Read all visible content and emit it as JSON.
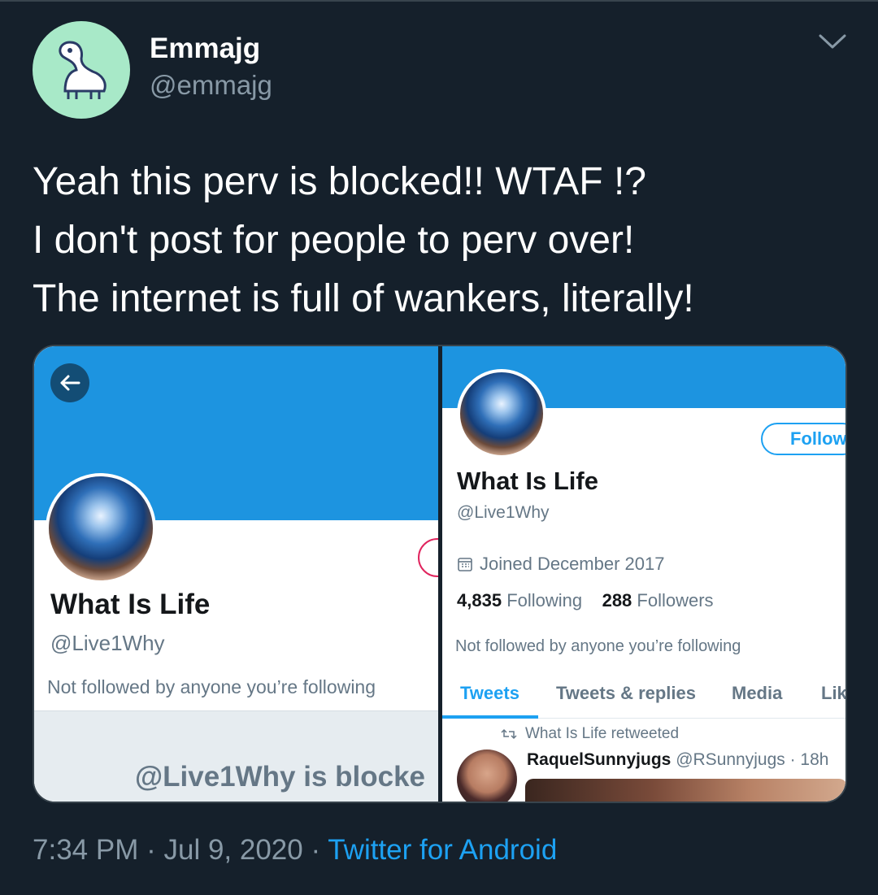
{
  "tweet": {
    "author_name": "Emmajg",
    "author_handle": "@emmajg",
    "text_lines": [
      "Yeah this perv is blocked!! WTAF !?",
      "I don't post for people to perv over!",
      "The internet is full of wankers, literally!"
    ],
    "time": "7:34 PM",
    "date": "Jul 9, 2020",
    "separator": "·",
    "source": "Twitter for Android"
  },
  "screenshot_left": {
    "profile_name": "What Is Life",
    "profile_handle": "@Live1Why",
    "not_followed": "Not followed by anyone you’re following",
    "blocked_text": "@Live1Why is blocke"
  },
  "screenshot_right": {
    "follow_label": "Follow",
    "profile_name": "What Is Life",
    "profile_handle": "@Live1Why",
    "joined": "Joined December 2017",
    "following_count": "4,835",
    "following_label": "Following",
    "followers_count": "288",
    "followers_label": "Followers",
    "not_followed": "Not followed by anyone you’re following",
    "tabs": [
      "Tweets",
      "Tweets & replies",
      "Media",
      "Lik"
    ],
    "retweet_note": "What Is Life retweeted",
    "rt_user_name": "RaquelSunnyjugs",
    "rt_user_handle": "@RSunnyjugs",
    "rt_time": "· 18h"
  },
  "icons": {
    "chevron": "chevron-down-icon",
    "back": "arrow-left-icon",
    "calendar": "calendar-icon",
    "retweet": "retweet-icon"
  },
  "colors": {
    "background": "#15202b",
    "accent": "#1da1f2",
    "banner": "#1d94e0",
    "muted": "#8899a6"
  }
}
